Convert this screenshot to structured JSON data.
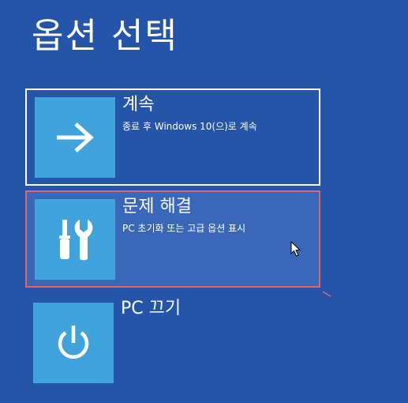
{
  "page": {
    "title": "옵션 선택"
  },
  "options": [
    {
      "label": "계속",
      "description": "종료 후 Windows 10(으)로 계속",
      "icon": "arrow-right-icon"
    },
    {
      "label": "문제 해결",
      "description": "PC 초기화 또는 고급 옵션 표시",
      "icon": "tools-icon"
    },
    {
      "label": "PC 끄기",
      "description": "",
      "icon": "power-icon"
    }
  ],
  "colors": {
    "background": "#2555a9",
    "tile": "#41a3dc",
    "selected_border": "#e0646c",
    "focus_border": "#ffffff"
  }
}
